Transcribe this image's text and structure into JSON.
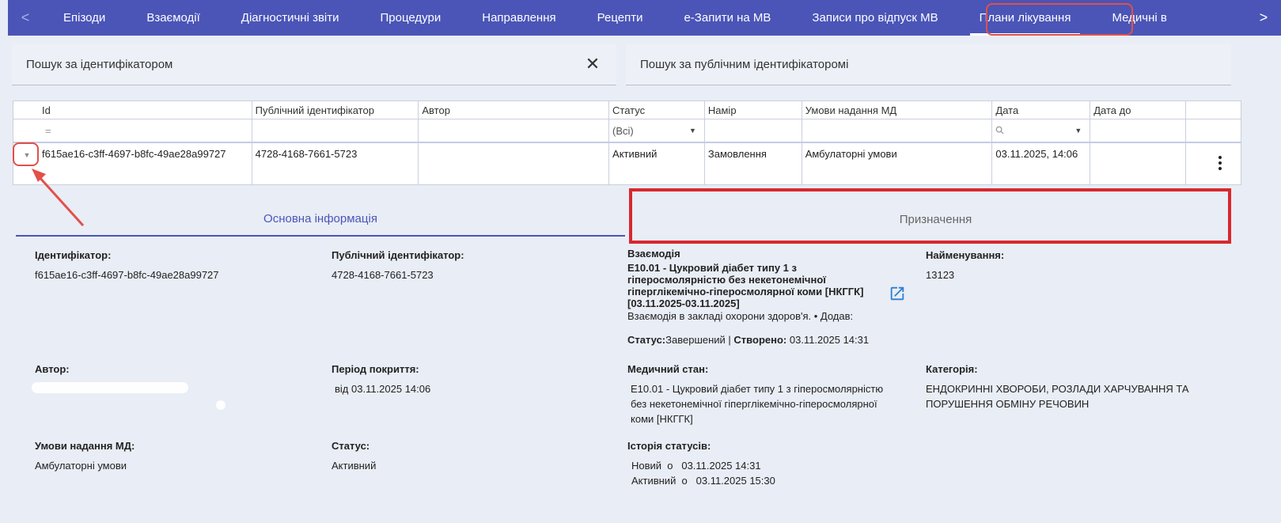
{
  "nav": {
    "prev_arrow": "<",
    "next_arrow": ">",
    "tabs": [
      {
        "label": "Епізоди"
      },
      {
        "label": "Взаємодії"
      },
      {
        "label": "Діагностичні звіти"
      },
      {
        "label": "Процедури"
      },
      {
        "label": "Направлення"
      },
      {
        "label": "Рецепти"
      },
      {
        "label": "е-Запити на МВ"
      },
      {
        "label": "Записи про відпуск МВ"
      },
      {
        "label": "Плани лікування"
      },
      {
        "label": "Медичні в"
      }
    ],
    "active_tab": "Плани лікування"
  },
  "search": {
    "by_id_placeholder": "Пошук за ідентифікатором",
    "by_public_id_placeholder": "Пошук за публічним ідентифікаторомі",
    "clear": "✕"
  },
  "table": {
    "columns": [
      "Id",
      "Публічний ідентифікатор",
      "Автор",
      "Статус",
      "Намір",
      "Умови надання МД",
      "Дата",
      "Дата до"
    ],
    "filters": {
      "id": "=",
      "status": "(Всі)",
      "date_icon": "search-icon"
    },
    "rows": [
      {
        "id": "f615ae16-c3ff-4697-b8fc-49ae28a99727",
        "public_id": "4728-4168-7661-5723",
        "author": "",
        "status": "Активний",
        "intent": "Замовлення",
        "conditions": "Амбулаторні умови",
        "date": "03.11.2025, 14:06",
        "date_to": ""
      }
    ]
  },
  "detail_tabs": {
    "main": "Основна інформація",
    "assignments": "Призначення"
  },
  "details": {
    "identifier_label": "Ідентифікатор:",
    "identifier_value": "f615ae16-c3ff-4697-b8fc-49ae28a99727",
    "public_id_label": "Публічний ідентифікатор:",
    "public_id_value": "4728-4168-7661-5723",
    "interaction_label": "Взаємодія",
    "interaction_title": "E10.01 - Цукровий діабет типу 1 з гіперосмолярністю без некетонемічної гіперглікемічно-гіперосмолярної коми [НКГГК] [03.11.2025-03.11.2025]",
    "interaction_sub": "Взаємодія в закладі охорони здоров'я. • Додав:",
    "interaction_status_label": "Статус:",
    "interaction_status_value": "Завершений",
    "interaction_created_label": "Створено:",
    "interaction_created_value": "03.11.2025 14:31",
    "name_label": "Найменування:",
    "name_value": "13123",
    "author_label": "Автор:",
    "period_label": "Період покриття:",
    "period_value": "від 03.11.2025 14:06",
    "condition_label": "Медичний стан:",
    "condition_value": "E10.01 - Цукровий діабет типу 1 з гіперосмолярністю без некетонемічної гіперглікемічно-гіперосмолярної коми [НКГГК]",
    "category_label": "Категорія:",
    "category_value": "ЕНДОКРИННІ ХВОРОБИ, РОЗЛАДИ ХАРЧУВАННЯ ТА ПОРУШЕННЯ ОБМІНУ РЕЧОВИН",
    "conditions_label": "Умови надання МД:",
    "conditions_value": "Амбулаторні умови",
    "status_label": "Статус:",
    "status_value": "Активний",
    "history_label": "Історія статусів:",
    "history": [
      "Новий  о   03.11.2025 14:31",
      "Активний  о   03.11.2025 15:30"
    ]
  },
  "colors": {
    "nav_bg": "#4a55b7",
    "annotation_red": "#d9272e"
  }
}
